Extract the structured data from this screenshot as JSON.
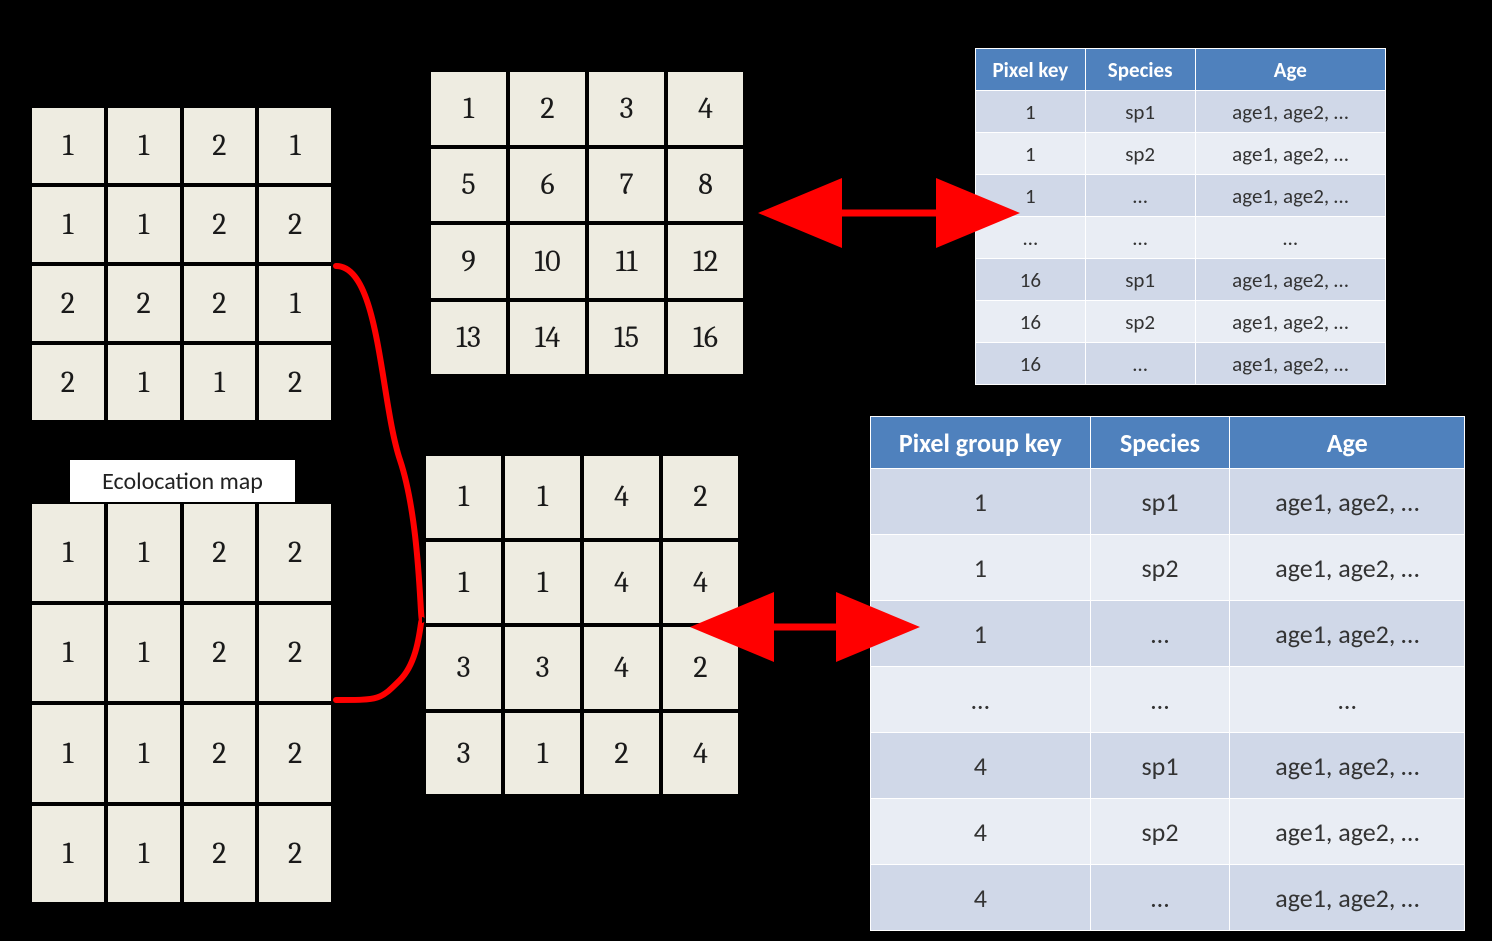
{
  "labels": {
    "ecolocation": "Ecolocation map"
  },
  "grids": {
    "top_left": [
      "1",
      "1",
      "2",
      "1",
      "1",
      "1",
      "2",
      "2",
      "2",
      "2",
      "2",
      "1",
      "2",
      "1",
      "1",
      "2"
    ],
    "bottom_left": [
      "1",
      "1",
      "2",
      "2",
      "1",
      "1",
      "2",
      "2",
      "1",
      "1",
      "2",
      "2",
      "1",
      "1",
      "2",
      "2"
    ],
    "top_mid": [
      "1",
      "2",
      "3",
      "4",
      "5",
      "6",
      "7",
      "8",
      "9",
      "10",
      "11",
      "12",
      "13",
      "14",
      "15",
      "16"
    ],
    "bottom_mid": [
      "1",
      "1",
      "4",
      "2",
      "1",
      "1",
      "4",
      "4",
      "3",
      "3",
      "4",
      "2",
      "3",
      "1",
      "2",
      "4"
    ]
  },
  "tables": {
    "top": {
      "headers": [
        "Pixel key",
        "Species",
        "Age"
      ],
      "rows": [
        [
          "1",
          "sp1",
          "age1, age2, …"
        ],
        [
          "1",
          "sp2",
          "age1, age2, …"
        ],
        [
          "1",
          "…",
          "age1, age2, …"
        ],
        [
          "…",
          "…",
          "…"
        ],
        [
          "16",
          "sp1",
          "age1, age2, …"
        ],
        [
          "16",
          "sp2",
          "age1, age2, …"
        ],
        [
          "16",
          "…",
          "age1, age2, …"
        ]
      ]
    },
    "bottom": {
      "headers": [
        "Pixel group key",
        "Species",
        "Age"
      ],
      "rows": [
        [
          "1",
          "sp1",
          "age1, age2, …"
        ],
        [
          "1",
          "sp2",
          "age1, age2, …"
        ],
        [
          "1",
          "…",
          "age1, age2, …"
        ],
        [
          "…",
          "…",
          "…"
        ],
        [
          "4",
          "sp1",
          "age1, age2, …"
        ],
        [
          "4",
          "sp2",
          "age1, age2, …"
        ],
        [
          "4",
          "…",
          "age1, age2, …"
        ]
      ]
    }
  }
}
